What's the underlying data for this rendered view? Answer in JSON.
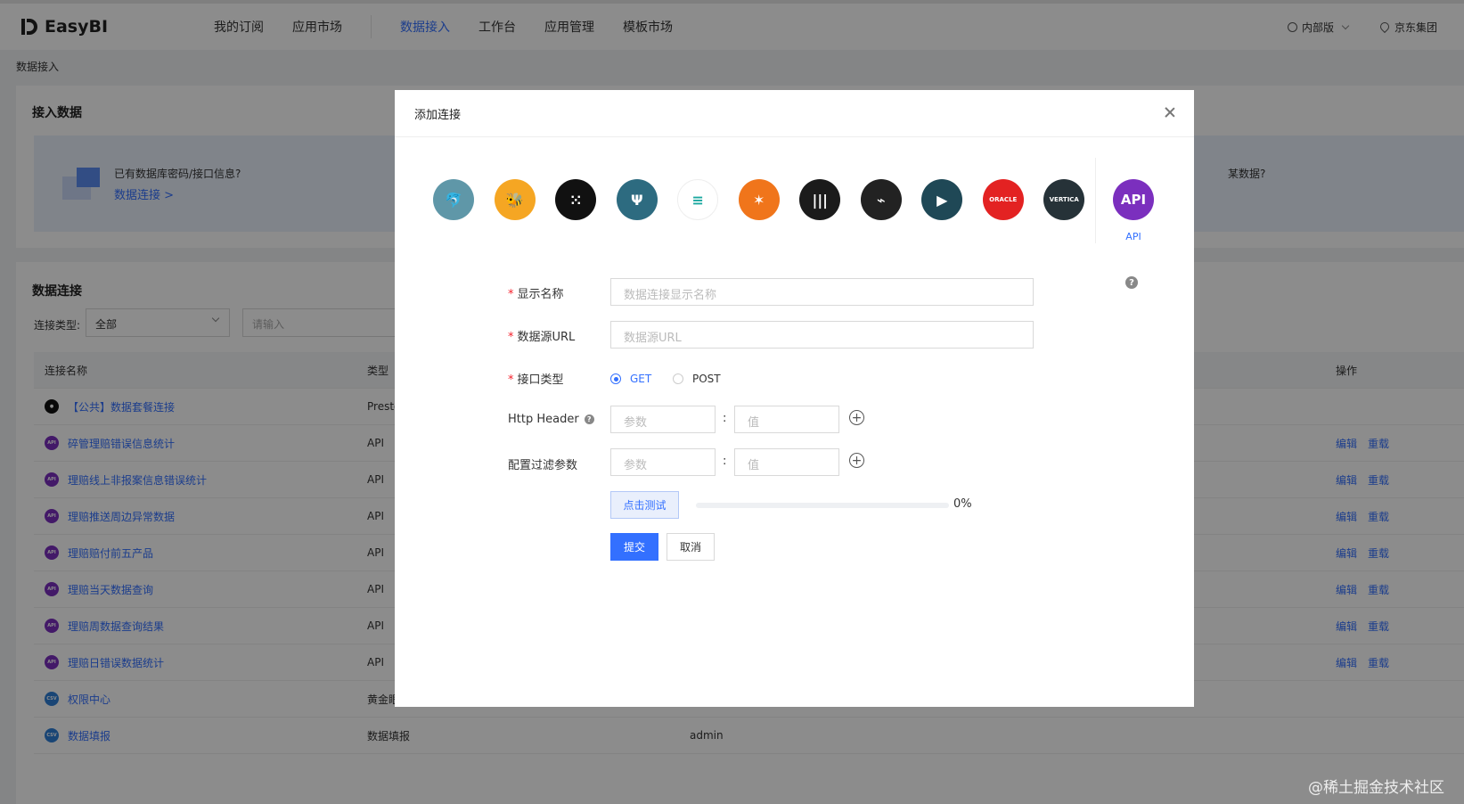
{
  "nav": {
    "logo": "EasyBI",
    "items": [
      "我的订阅",
      "应用市场",
      "数据接入",
      "工作台",
      "应用管理",
      "模板市场"
    ],
    "active_index": 2,
    "edition": "内部版",
    "org": "京东集团"
  },
  "breadcrumb": "数据接入",
  "import_card": {
    "title": "接入数据",
    "banner_text": "已有数据库密码/接口信息?",
    "banner_link": "数据连接 >",
    "banner_right": "某数据?"
  },
  "connections": {
    "title": "数据连接",
    "filter_label": "连接类型:",
    "filter_value": "全部",
    "search_placeholder": "请输入",
    "columns": [
      "连接名称",
      "类型",
      "",
      "操作"
    ],
    "rows": [
      {
        "name": "【公共】数据套餐连接",
        "type": "Presto",
        "owner": "",
        "actions": [],
        "icon_color": "#111111",
        "icon_text": "●"
      },
      {
        "name": "碎管理赔错误信息统计",
        "type": "API",
        "owner": "",
        "actions": [
          "编辑",
          "重载"
        ],
        "icon_color": "#7b2fbe",
        "icon_text": "API"
      },
      {
        "name": "理赔线上非报案信息错误统计",
        "type": "API",
        "owner": "",
        "actions": [
          "编辑",
          "重载"
        ],
        "icon_color": "#7b2fbe",
        "icon_text": "API"
      },
      {
        "name": "理赔推送周边异常数据",
        "type": "API",
        "owner": "",
        "actions": [
          "编辑",
          "重载"
        ],
        "icon_color": "#7b2fbe",
        "icon_text": "API"
      },
      {
        "name": "理赔赔付前五产品",
        "type": "API",
        "owner": "",
        "actions": [
          "编辑",
          "重载"
        ],
        "icon_color": "#7b2fbe",
        "icon_text": "API"
      },
      {
        "name": "理赔当天数据查询",
        "type": "API",
        "owner": "",
        "actions": [
          "编辑",
          "重载"
        ],
        "icon_color": "#7b2fbe",
        "icon_text": "API"
      },
      {
        "name": "理赔周数据查询结果",
        "type": "API",
        "owner": "",
        "actions": [
          "编辑",
          "重载"
        ],
        "icon_color": "#7b2fbe",
        "icon_text": "API"
      },
      {
        "name": "理赔日错误数据统计",
        "type": "API",
        "owner": "",
        "actions": [
          "编辑",
          "重载"
        ],
        "icon_color": "#7b2fbe",
        "icon_text": "API"
      },
      {
        "name": "权限中心",
        "type": "黄金眼",
        "owner": "",
        "actions": [],
        "icon_color": "#2f7fd6",
        "icon_text": "CSV"
      },
      {
        "name": "数据填报",
        "type": "数据填报",
        "owner": "admin",
        "actions": [],
        "icon_color": "#2f7fd6",
        "icon_text": "CSV"
      }
    ]
  },
  "modal": {
    "title": "添加连接",
    "sources": [
      {
        "icon": "mysql-icon",
        "color": "#5f97a8",
        "glyph": "🐬"
      },
      {
        "icon": "hive-icon",
        "color": "#f5a623",
        "glyph": "🐝"
      },
      {
        "icon": "presto-icon",
        "color": "#111111",
        "glyph": "⁙"
      },
      {
        "icon": "impala-icon",
        "color": "#2d6b80",
        "glyph": "Ψ"
      },
      {
        "icon": "elasticsearch-icon",
        "color": "#ffffff",
        "glyph": "≡"
      },
      {
        "icon": "spark-icon",
        "color": "#f0751b",
        "glyph": "✶"
      },
      {
        "icon": "clickhouse-icon",
        "color": "#1b1b1b",
        "glyph": "|||"
      },
      {
        "icon": "sqlserver-icon",
        "color": "#222222",
        "glyph": "⌁"
      },
      {
        "icon": "kylin-icon",
        "color": "#1f4856",
        "glyph": "▶"
      },
      {
        "icon": "oracle-icon",
        "color": "#e32222",
        "glyph": "ORACLE"
      },
      {
        "icon": "vertica-icon",
        "color": "#263238",
        "glyph": "VERTICA"
      }
    ],
    "api_source": {
      "icon_text": "API",
      "label": "API"
    },
    "fields": {
      "display_name_label": "显示名称",
      "display_name_placeholder": "数据连接显示名称",
      "url_label": "数据源URL",
      "url_placeholder": "数据源URL",
      "method_label": "接口类型",
      "methods": [
        "GET",
        "POST"
      ],
      "selected_method": "GET",
      "header_label": "Http Header",
      "param_placeholder": "参数",
      "value_placeholder": "值",
      "filter_label": "配置过滤参数"
    },
    "test_button": "点击测试",
    "progress": 0,
    "progress_text": "0%",
    "submit": "提交",
    "cancel": "取消"
  },
  "watermark": "@稀土掘金技术社区"
}
